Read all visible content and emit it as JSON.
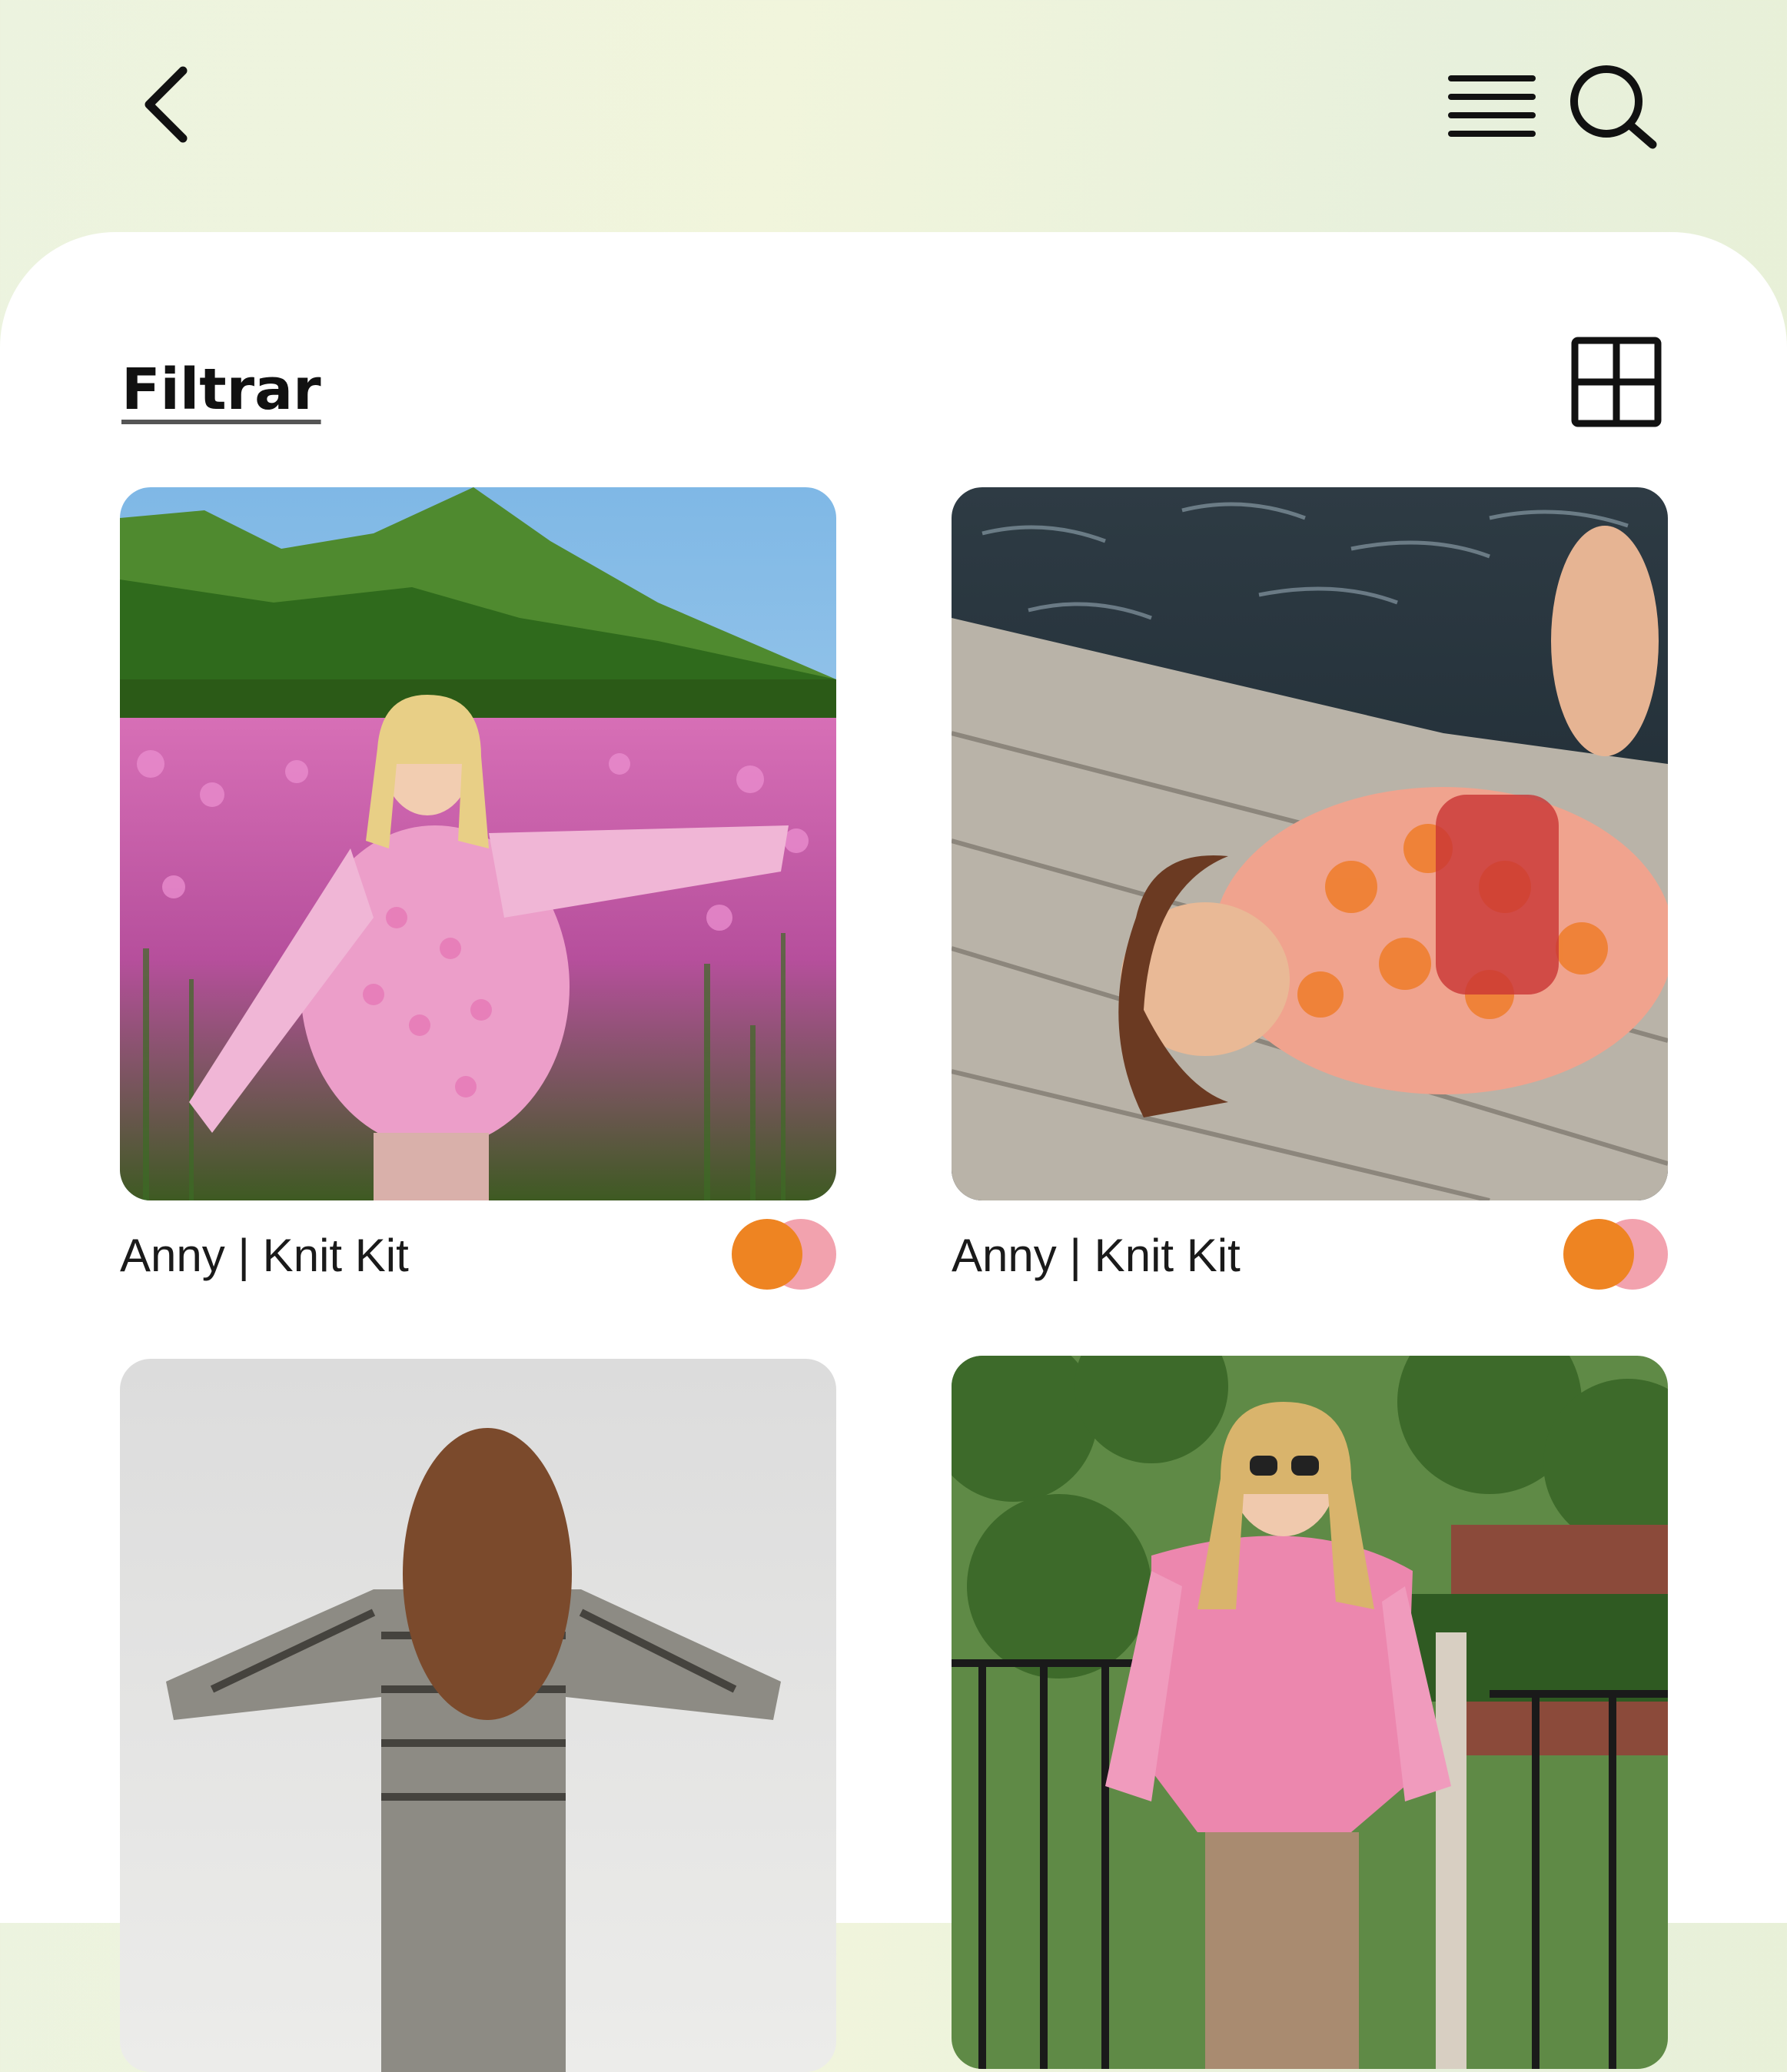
{
  "header": {
    "back_icon": "chevron-left-icon",
    "menu_icon": "hamburger-menu-icon",
    "search_icon": "search-icon"
  },
  "toolbar": {
    "filter_label": "Filtrar",
    "view_toggle_icon": "grid-view-icon"
  },
  "colors": {
    "orange": "#ee8422",
    "pink": "#f2a2ae"
  },
  "products": [
    {
      "title": "Anny | Knit Kit",
      "image": "woman in pink patterned sweater in flower field with mountains",
      "swatches": [
        "#ee8422",
        "#f2a2ae"
      ]
    },
    {
      "title": "Anny | Knit Kit",
      "image": "woman in orange and pink sweater lying on wooden dock by water",
      "swatches": [
        "#ee8422",
        "#f2a2ae"
      ]
    },
    {
      "title": "",
      "image": "woman from behind in black and white patterned cardigan against sky"
    },
    {
      "title": "",
      "image": "woman in pink sweater and sunglasses in front of trees and fence"
    }
  ]
}
